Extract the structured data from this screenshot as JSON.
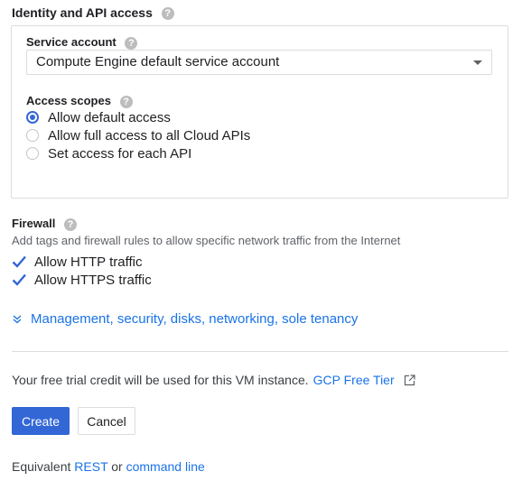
{
  "identity": {
    "title": "Identity and API access",
    "help_glyph": "?",
    "service_account": {
      "label": "Service account",
      "selected": "Compute Engine default service account"
    },
    "access_scopes": {
      "label": "Access scopes",
      "options": [
        {
          "label": "Allow default access",
          "selected": true
        },
        {
          "label": "Allow full access to all Cloud APIs",
          "selected": false
        },
        {
          "label": "Set access for each API",
          "selected": false
        }
      ]
    }
  },
  "firewall": {
    "title": "Firewall",
    "description": "Add tags and firewall rules to allow specific network traffic from the Internet",
    "options": [
      {
        "label": "Allow HTTP traffic",
        "checked": true
      },
      {
        "label": "Allow HTTPS traffic",
        "checked": true
      }
    ]
  },
  "expand_link": "Management, security, disks, networking, sole tenancy",
  "trial": {
    "text": "Your free trial credit will be used for this VM instance.",
    "link": "GCP Free Tier"
  },
  "buttons": {
    "create": "Create",
    "cancel": "Cancel"
  },
  "equivalent": {
    "prefix": "Equivalent",
    "rest": "REST",
    "or": "or",
    "command_line": "command line"
  },
  "colors": {
    "accent": "#3367d6",
    "link": "#1a73e8"
  },
  "icons": {
    "help": "help-icon",
    "dropdown": "caret-down-icon",
    "checkbox": "checkmark-icon",
    "expand": "chevron-down-icon",
    "external": "external-link-icon"
  }
}
